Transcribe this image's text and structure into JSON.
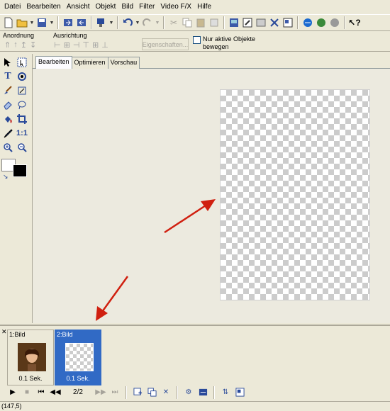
{
  "menu": [
    "Datei",
    "Bearbeiten",
    "Ansicht",
    "Objekt",
    "Bild",
    "Filter",
    "Video F/X",
    "Hilfe"
  ],
  "arrange": {
    "anordnung_label": "Anordnung",
    "ausrichtung_label": "Ausrichtung",
    "properties_button": "Eigenschaften...",
    "only_active_label": "Nur aktive Objekte bewegen"
  },
  "tabs": [
    "Bearbeiten",
    "Optimieren",
    "Vorschau"
  ],
  "frames": [
    {
      "label": "1:Bild",
      "duration": "0.1 Sek."
    },
    {
      "label": "2:Bild",
      "duration": "0.1 Sek."
    }
  ],
  "playback": {
    "counter": "2/2"
  },
  "status": {
    "coords": "(147,5)"
  },
  "colors": {
    "selection": "#316ac5",
    "arrow": "#d02010",
    "foreground": "#000000",
    "background": "#ffffff"
  },
  "icons": {
    "toolbar": [
      "new-file-icon",
      "open-folder-icon",
      "save-icon",
      "import-icon",
      "export-icon",
      "cursor-options-icon",
      "undo-icon",
      "redo-icon",
      "cut-icon",
      "copy-icon",
      "paste-icon",
      "duplicate-icon",
      "image-properties-icon",
      "edit-icon",
      "crop-icon",
      "delete-icon",
      "resize-icon",
      "web-icon",
      "browser-preview-icon",
      "help-icon",
      "context-help-icon"
    ],
    "tools": [
      "select-icon",
      "marquee-icon",
      "text-icon",
      "shape-icon",
      "brush-icon",
      "transform-icon",
      "eraser-icon",
      "lasso-icon",
      "fill-icon",
      "crop-tool-icon",
      "eyedropper-icon",
      "actual-size-icon",
      "zoom-in-icon",
      "zoom-out-icon"
    ]
  }
}
